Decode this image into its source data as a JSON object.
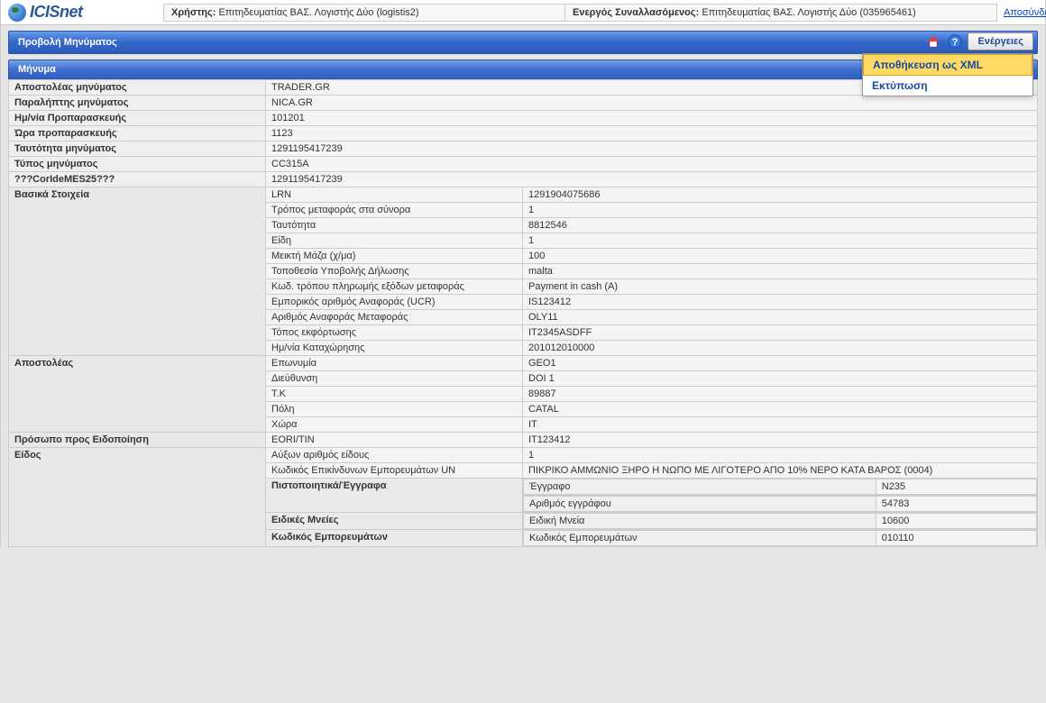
{
  "app": {
    "logo": "ICISnet",
    "user_label": "Χρήστης:",
    "user_value": "Επιτηδευματίας ΒΑΣ. Λογιστής Δύο (logistis2)",
    "active_label": "Ενεργός Συναλλασόμενος:",
    "active_value": "Επιτηδευματίας ΒΑΣ. Λογιστής Δύο (035965461)",
    "logout": "Αποσύνδεση"
  },
  "titlebar": {
    "title": "Προβολή Μηνύματος",
    "actions": "Ενέργειες"
  },
  "menu": {
    "save_xml": "Αποθήκευση ως XML",
    "print": "Εκτύπωση"
  },
  "section_header": "Μήνυμα",
  "rows": [
    {
      "label": "Αποστολέας μηνύματος",
      "value": "TRADER.GR"
    },
    {
      "label": "Παραλήπτης μηνύματος",
      "value": "NICA.GR"
    },
    {
      "label": "Ημ/νία Προπαρασκευής",
      "value": "101201"
    },
    {
      "label": "Ώρα προπαρασκευής",
      "value": "1123"
    },
    {
      "label": "Ταυτότητα μηνύματος",
      "value": "1291195417239"
    },
    {
      "label": "Τύπος μηνύματος",
      "value": "CC315A"
    },
    {
      "label": "???CorIdeMES25???",
      "value": "1291195417239"
    }
  ],
  "basic": {
    "label": "Βασικά Στοιχεία",
    "items": [
      {
        "label": "LRN",
        "value": "1291904075686"
      },
      {
        "label": "Τρόπος μεταφοράς στα σύνορα",
        "value": "1"
      },
      {
        "label": "Ταυτότητα",
        "value": "8812546"
      },
      {
        "label": "Είδη",
        "value": "1"
      },
      {
        "label": "Μεικτή Μάζα (χ/μα)",
        "value": "100"
      },
      {
        "label": "Τοποθεσία Υποβολής Δήλωσης",
        "value": "malta"
      },
      {
        "label": "Κωδ. τρόπου πληρωμής εξόδων μεταφοράς",
        "value": "Payment in cash (A)"
      },
      {
        "label": "Εμπορικός αριθμός Αναφοράς (UCR)",
        "value": "IS123412"
      },
      {
        "label": "Αριθμός Αναφοράς Μεταφοράς",
        "value": "OLY11"
      },
      {
        "label": "Τόπος εκφόρτωσης",
        "value": "IT2345ASDFF"
      },
      {
        "label": "Ημ/νία Καταχώρησης",
        "value": "201012010000"
      }
    ]
  },
  "sender": {
    "label": "Αποστολέας",
    "items": [
      {
        "label": "Επωνυμία",
        "value": "GEO1"
      },
      {
        "label": "Διεύθυνση",
        "value": "DOI 1"
      },
      {
        "label": "Τ.Κ",
        "value": "89887"
      },
      {
        "label": "Πόλη",
        "value": "CATAL"
      },
      {
        "label": "Χώρα",
        "value": "IT"
      }
    ]
  },
  "notify": {
    "label": "Πρόσωπο προς Ειδοποίηση",
    "items": [
      {
        "label": "EORI/TIN",
        "value": "IT123412"
      }
    ]
  },
  "kind": {
    "label": "Είδος",
    "top_items": [
      {
        "label": "Αύξων αριθμός είδους",
        "value": "1"
      },
      {
        "label": "Κωδικός Επικίνδυνων Εμπορευμάτων UN",
        "value": "ΠΙΚΡΙΚΟ ΑΜΜΩΝΙΟ ΞΗΡΟ Η ΝΩΠΟ ΜΕ ΛΙΓΟΤΕΡΟ ΑΠΟ 10% ΝΕΡΟ ΚΑΤΑ ΒΑΡΟΣ (0004)"
      }
    ],
    "docs": {
      "header": "Πιστοποιητικά/Έγγραφα",
      "rows": [
        {
          "label": "Έγγραφο",
          "value": "N235"
        },
        {
          "label": "Αριθμός εγγράφου",
          "value": "54783"
        }
      ]
    },
    "special": {
      "header": "Ειδικές Μνείες",
      "rows": [
        {
          "label": "Ειδική Μνεία",
          "value": "10600"
        }
      ]
    },
    "commodity": {
      "header": "Κωδικός Εμπορευμάτων",
      "rows": [
        {
          "label": "Κωδικός Εμπορευμάτων",
          "value": "010110"
        }
      ]
    }
  }
}
